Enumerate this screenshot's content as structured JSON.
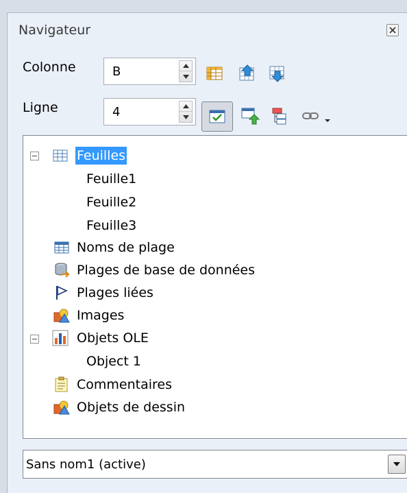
{
  "window": {
    "title": "Navigateur"
  },
  "controls": {
    "column": {
      "label": "Colonne",
      "value": "B"
    },
    "row": {
      "label": "Ligne",
      "value": "4"
    }
  },
  "tree": {
    "sheets": {
      "label": "Feuilles",
      "children": [
        "Feuille1",
        "Feuille2",
        "Feuille3"
      ]
    },
    "range_names": {
      "label": "Noms de plage"
    },
    "database_ranges": {
      "label": "Plages de base de données"
    },
    "linked_areas": {
      "label": "Plages liées"
    },
    "images": {
      "label": "Images"
    },
    "ole_objects": {
      "label": "Objets OLE",
      "children": [
        "Object 1"
      ]
    },
    "comments": {
      "label": "Commentaires"
    },
    "drawing_objects": {
      "label": "Objets de dessin"
    }
  },
  "document_select": {
    "value": "Sans nom1 (active)"
  },
  "colors": {
    "selection": "#3399ff",
    "panel_bg": "#eaf0f8"
  }
}
